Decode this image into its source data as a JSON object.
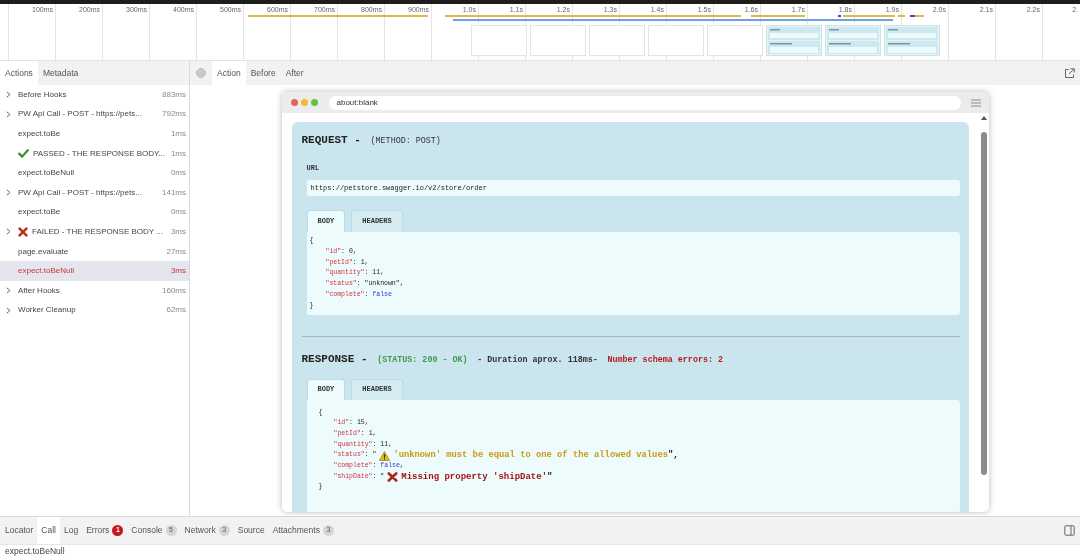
{
  "timeline": {
    "ticks": [
      "100ms",
      "200ms",
      "300ms",
      "400ms",
      "500ms",
      "600ms",
      "700ms",
      "800ms",
      "900ms",
      "1.0s",
      "1.1s",
      "1.2s",
      "1.3s",
      "1.4s",
      "1.5s",
      "1.6s",
      "1.7s",
      "1.8s",
      "1.9s",
      "2.0s",
      "2.1s",
      "2.2s",
      "2."
    ],
    "thumbnails": [
      {
        "kind": "blank"
      },
      {
        "kind": "blank"
      },
      {
        "kind": "blank"
      },
      {
        "kind": "blank"
      },
      {
        "kind": "blank"
      },
      {
        "kind": "snapshot"
      },
      {
        "kind": "snapshot"
      },
      {
        "kind": "snapshot"
      }
    ]
  },
  "sidebar": {
    "tabs": [
      {
        "label": "Actions",
        "selected": true
      },
      {
        "label": "Metadata",
        "selected": false
      }
    ],
    "actions": [
      {
        "label": "Before Hooks",
        "duration": "883ms",
        "kind": "group",
        "expanded": false,
        "selected": false,
        "error": false
      },
      {
        "label": "PW Api Call - POST - https://pets...",
        "duration": "792ms",
        "kind": "group",
        "expanded": false,
        "selected": false,
        "error": false
      },
      {
        "label": "expect.toBe",
        "duration": "1ms",
        "kind": "step",
        "selected": false,
        "error": false
      },
      {
        "label": "PASSED - THE RESPONSE BODY...",
        "duration": "1ms",
        "kind": "pass",
        "selected": false,
        "error": false
      },
      {
        "label": "expect.toBeNull",
        "duration": "0ms",
        "kind": "step",
        "selected": false,
        "error": false
      },
      {
        "label": "PW Api Call - POST - https://pets...",
        "duration": "141ms",
        "kind": "group",
        "expanded": false,
        "selected": false,
        "error": false
      },
      {
        "label": "expect.toBe",
        "duration": "0ms",
        "kind": "step",
        "selected": false,
        "error": false
      },
      {
        "label": "FAILED - THE RESPONSE BODY ...",
        "duration": "3ms",
        "kind": "fail",
        "expanded": false,
        "selected": false,
        "error": false
      },
      {
        "label": "page.evaluate",
        "duration": "27ms",
        "kind": "step",
        "selected": false,
        "error": false
      },
      {
        "label": "expect.toBeNull",
        "duration": "3ms",
        "kind": "step",
        "selected": true,
        "error": true
      },
      {
        "label": "After Hooks",
        "duration": "160ms",
        "kind": "group",
        "expanded": false,
        "selected": false,
        "error": false
      },
      {
        "label": "Worker Cleanup",
        "duration": "62ms",
        "kind": "group",
        "expanded": false,
        "selected": false,
        "error": false
      }
    ]
  },
  "viewer": {
    "tabs": [
      {
        "label": "Action",
        "selected": true
      },
      {
        "label": "Before",
        "selected": false
      },
      {
        "label": "After",
        "selected": false
      }
    ],
    "snapshot": {
      "address": "about:blank",
      "sections": [
        {
          "kind": "request",
          "title": "REQUEST -",
          "parts": [
            {
              "text": "(METHOD: POST)",
              "kind": "muted"
            }
          ],
          "url_label": "URL",
          "url": "https://petstore.swagger.io/v2/store/order",
          "tabs": [
            {
              "label": "BODY",
              "selected": true
            },
            {
              "label": "HEADERS",
              "selected": false
            }
          ],
          "body": {
            "open": "{",
            "entries": [
              {
                "key": "\"id\"",
                "sep": ":",
                "value": "0",
                "kind": "number",
                "comma": ","
              },
              {
                "key": "\"petId\"",
                "sep": ":",
                "value": "1",
                "kind": "number",
                "comma": ","
              },
              {
                "key": "\"quantity\"",
                "sep": ":",
                "value": "11",
                "kind": "number",
                "comma": ","
              },
              {
                "key": "\"status\"",
                "sep": ":",
                "value": "\"unknown\"",
                "kind": "string",
                "comma": ","
              },
              {
                "key": "\"complete\"",
                "sep": ":",
                "value": "false",
                "kind": "boolean"
              }
            ],
            "close": "}"
          }
        },
        {
          "kind": "response",
          "title": "RESPONSE -",
          "parts": [
            {
              "text": "(STATUS: 200 - OK)",
              "kind": "success"
            },
            {
              "text": "- Duration aprox. 118ms-",
              "kind": "plain"
            },
            {
              "text": "Number schema errors: 2",
              "kind": "danger"
            }
          ],
          "tabs": [
            {
              "label": "BODY",
              "selected": true
            },
            {
              "label": "HEADERS",
              "selected": false
            }
          ],
          "body": {
            "open": "{",
            "entries": [
              {
                "key": "\"id\"",
                "sep": ":",
                "value": "15",
                "kind": "number",
                "comma": ","
              },
              {
                "key": "\"petId\"",
                "sep": ":",
                "value": "1",
                "kind": "number",
                "comma": ","
              },
              {
                "key": "\"quantity\"",
                "sep": ":",
                "value": "11",
                "kind": "number",
                "comma": ","
              },
              {
                "key": "\"status\"",
                "sep": ":",
                "kind": "warning",
                "quote": "\"",
                "message": "'unknown' must be equal to one of the allowed values",
                "end_quote": "\"",
                "comma": ","
              },
              {
                "key": "\"complete\"",
                "sep": ":",
                "value": "false",
                "kind": "boolean",
                "comma": ","
              },
              {
                "key": "\"shipDate\"",
                "sep": ":",
                "kind": "error",
                "quote": "\"",
                "message": "Missing property 'shipDate'",
                "end_quote": "\""
              }
            ],
            "close": "}"
          }
        }
      ]
    }
  },
  "details": {
    "tabs": [
      {
        "label": "Locator",
        "selected": false
      },
      {
        "label": "Call",
        "selected": true
      },
      {
        "label": "Log",
        "selected": false
      },
      {
        "label": "Errors",
        "selected": false,
        "count": "1",
        "alert": true
      },
      {
        "label": "Console",
        "selected": false,
        "count": "5",
        "alert": false
      },
      {
        "label": "Network",
        "selected": false,
        "count": "3",
        "alert": false
      },
      {
        "label": "Source",
        "selected": false
      },
      {
        "label": "Attachments",
        "selected": false,
        "count": "3",
        "alert": false
      }
    ],
    "content": "expect.toBeNull"
  }
}
